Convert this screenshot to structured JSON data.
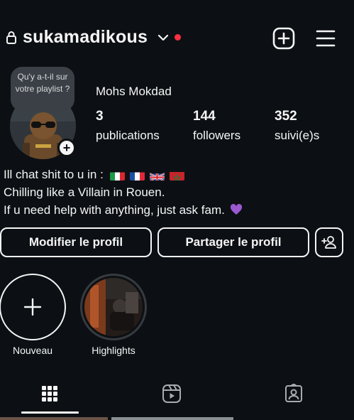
{
  "header": {
    "username": "sukamadikous",
    "icons": [
      "lock-icon",
      "chevron-down-icon",
      "notification-dot",
      "create-post-icon",
      "hamburger-menu-icon"
    ],
    "dot_color": "#ff3040"
  },
  "profile": {
    "note_text": "Qu'y a-t-il sur votre playlist ?",
    "full_name": "Mohs Mokdad",
    "stats": [
      {
        "value": "3",
        "label": "publications"
      },
      {
        "value": "144",
        "label": "followers"
      },
      {
        "value": "352",
        "label": "suivi(e)s"
      }
    ]
  },
  "bio": {
    "line1": "Ill chat shit to u in :",
    "line1_flags": [
      "flag-italy",
      "flag-france",
      "flag-uk",
      "flag-morocco"
    ],
    "line2": "Chilling like a Villain in Rouen.",
    "line3": "If u need help with anything, just ask fam.",
    "line3_emoji": "purple-heart"
  },
  "actions": {
    "edit_label": "Modifier le profil",
    "share_label": "Partager le profil",
    "discover_icon": "add-person-icon"
  },
  "highlights": [
    {
      "label": "Nouveau",
      "icon": "plus-icon"
    },
    {
      "label": "Highlights",
      "icon": "highlight-cover"
    }
  ],
  "tabs": [
    {
      "name": "posts-grid",
      "icon": "grid-icon",
      "selected": true
    },
    {
      "name": "reels",
      "icon": "reels-icon",
      "selected": false
    },
    {
      "name": "tagged",
      "icon": "tagged-icon",
      "selected": false
    }
  ],
  "colors": {
    "background": "#0c1014",
    "foreground": "#f5f5f5",
    "note_bubble": "#3a4046",
    "highlight_ring": "#363b40"
  }
}
